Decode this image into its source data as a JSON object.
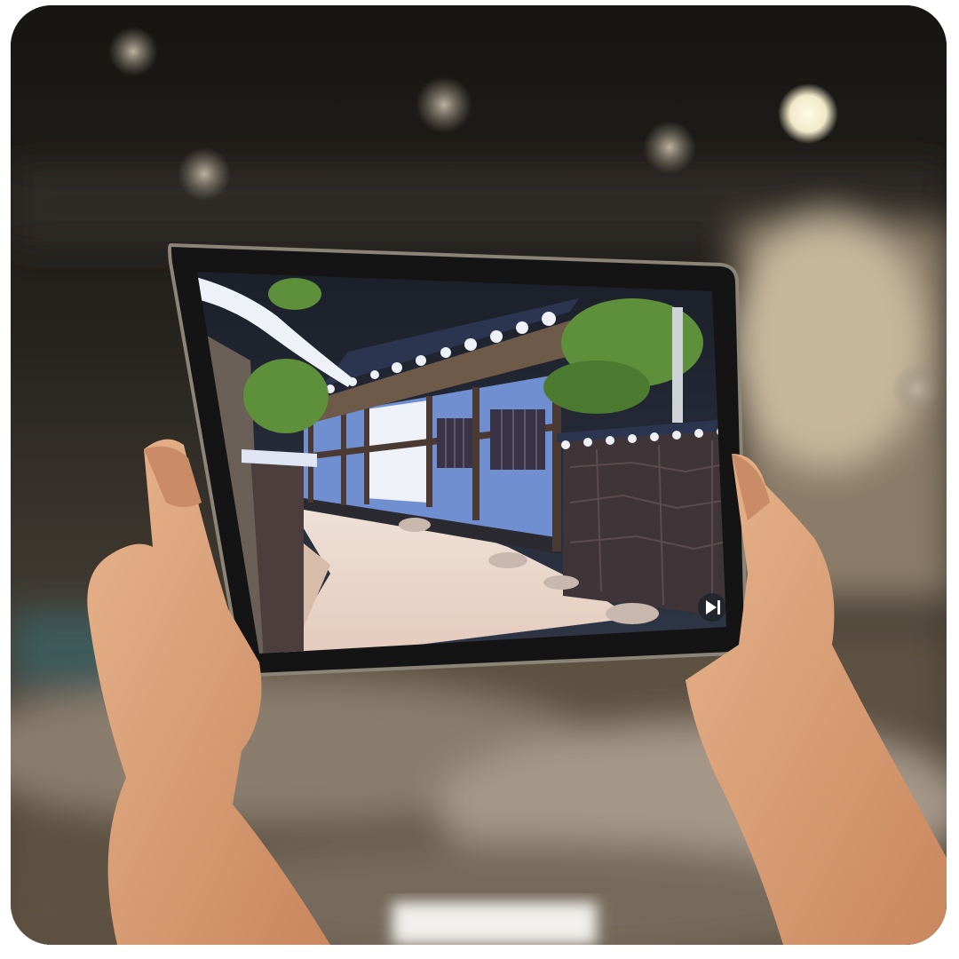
{
  "photo": {
    "subject": "hands-holding-tablet-showing-ar-hanok-alley",
    "colors": {
      "ceiling": "#1c1a17",
      "floor": "#4a4034",
      "wall_blue": "#6f8fd0",
      "wall_white": "#eef1f8",
      "roof_dark": "#2b3550",
      "stone": "#3f3538",
      "path": "#e9d9cf",
      "foliage": "#5e8f3a",
      "skin": "#d79f78",
      "bezel": "#141414"
    }
  },
  "screen_overlay": {
    "icon": "play-skip-icon"
  }
}
